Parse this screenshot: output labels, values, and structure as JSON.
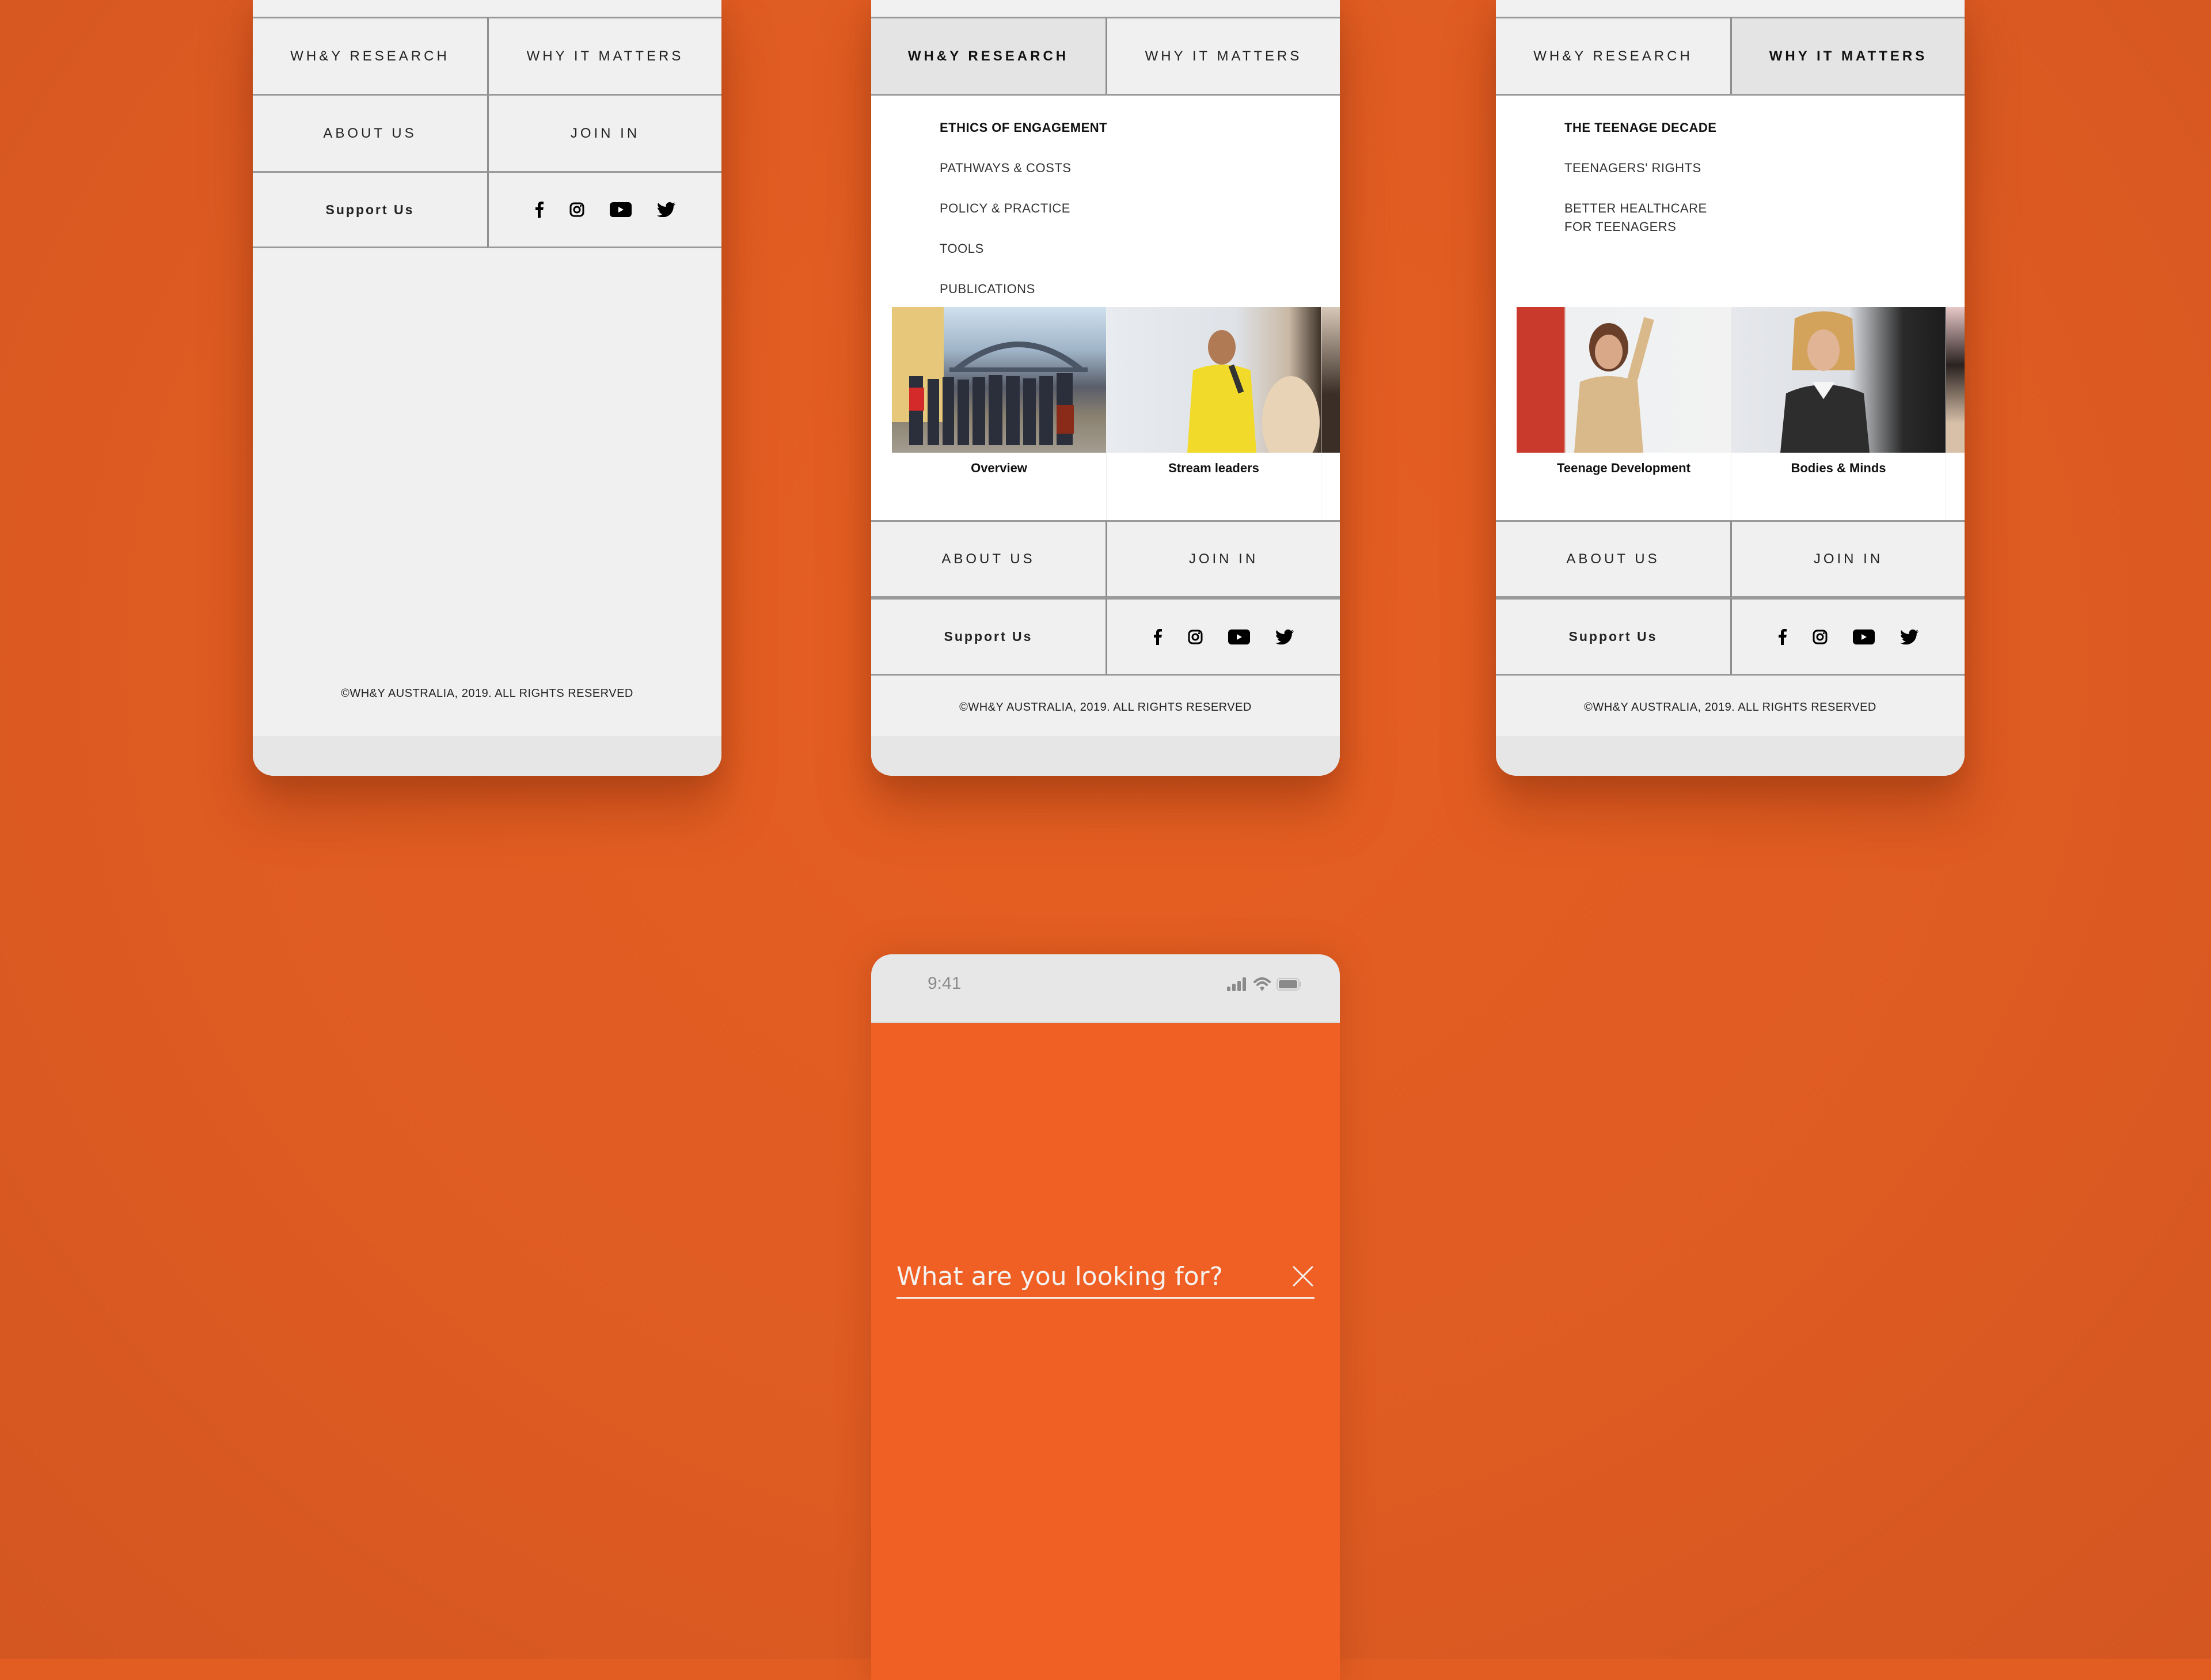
{
  "colors": {
    "background": "#E25D22",
    "accent_orange": "#F05F23",
    "menu_bg": "#F0F0F0",
    "active_tab_bg": "#E4E4E4",
    "text": "#222222"
  },
  "nav": {
    "primary": [
      "WH&Y RESEARCH",
      "WHY IT MATTERS"
    ],
    "secondary": [
      "ABOUT US",
      "JOIN IN"
    ],
    "support_label": "Support Us",
    "social_icons": [
      "facebook-icon",
      "instagram-icon",
      "youtube-icon",
      "twitter-icon"
    ]
  },
  "copyright": "©WH&Y AUSTRALIA, 2019. ALL RIGHTS RESERVED",
  "screens": [
    {
      "name": "menu-collapsed",
      "active_tab": null
    },
    {
      "name": "menu-research-open",
      "active_tab": "WH&Y RESEARCH",
      "submenu": [
        "ETHICS OF ENGAGEMENT",
        "PATHWAYS & COSTS",
        "POLICY & PRACTICE",
        "TOOLS",
        "PUBLICATIONS"
      ],
      "cards": [
        {
          "caption": "Overview",
          "photo": "group photo at Sydney Harbour Bridge"
        },
        {
          "caption": "Stream leaders",
          "photo": "speaker in yellow shirt with microphone"
        }
      ]
    },
    {
      "name": "menu-why-open",
      "active_tab": "WHY IT MATTERS",
      "submenu": [
        "THE TEENAGE DECADE",
        "TEENAGERS' RIGHTS",
        "BETTER HEALTHCARE\nFOR TEENAGERS"
      ],
      "cards": [
        {
          "caption": "Teenage Development",
          "photo": "woman in floral top at whiteboard"
        },
        {
          "caption": "Bodies & Minds",
          "photo": "smiling woman in black jacket"
        }
      ]
    }
  ],
  "search_screen": {
    "status_time": "9:41",
    "status_icons": [
      "signal-icon",
      "wifi-icon",
      "battery-icon"
    ],
    "placeholder": "What are you looking for?",
    "close_icon": "close-icon"
  }
}
